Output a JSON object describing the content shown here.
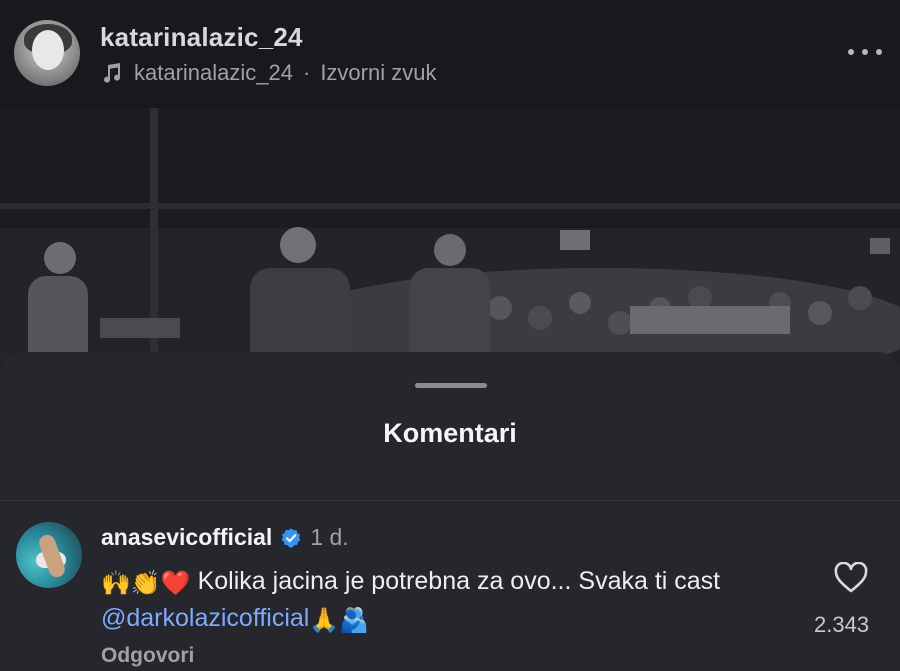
{
  "header": {
    "username": "katarinalazic_24",
    "audio_owner": "katarinalazic_24",
    "audio_separator": "·",
    "audio_label": "Izvorni zvuk",
    "icons": {
      "audio": "music-note-icon",
      "more": "more-options-icon"
    }
  },
  "video": {
    "description_hidden": true
  },
  "comments_sheet": {
    "title": "Komentari",
    "comments": [
      {
        "username": "anasevicofficial",
        "verified": true,
        "time": "1 d.",
        "emoji_prefix": "🙌👏❤️",
        "text_part1": " Kolika jacina je potrebna za ovo... Svaka ti cast ",
        "mention": "@darkolazicofficial",
        "emoji_suffix": " 🙏🫂",
        "like_count": "2.343",
        "reply_label": "Odgovori"
      }
    ]
  },
  "colors": {
    "background": "#141519",
    "sheet": "#25272c",
    "mention": "#7fa9ff",
    "verified": "#3a91f5"
  }
}
